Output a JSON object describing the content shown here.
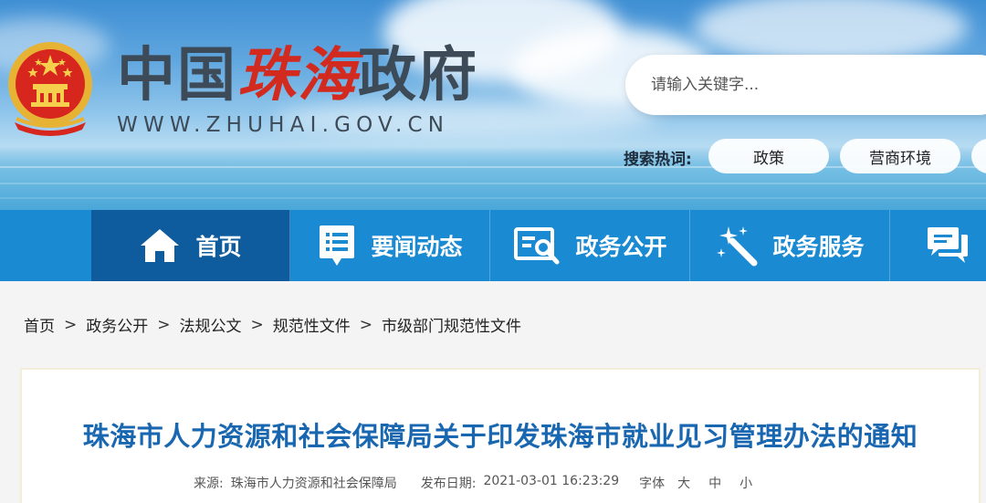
{
  "header": {
    "site_title_part1": "中国",
    "site_title_part2": "珠海",
    "site_title_part3": "政府",
    "domain": "WWW.ZHUHAI.GOV.CN",
    "search_placeholder": "请输入关键字...",
    "hot_label": "搜索热词:",
    "hot_words": [
      "政策",
      "营商环境"
    ]
  },
  "nav": {
    "items": [
      {
        "label": "首页",
        "icon": "home-icon",
        "active": true
      },
      {
        "label": "要闻动态",
        "icon": "news-list-icon"
      },
      {
        "label": "政务公开",
        "icon": "open-gov-icon"
      },
      {
        "label": "政务服务",
        "icon": "magic-wand-icon"
      },
      {
        "label": "",
        "icon": "chat-icon"
      }
    ]
  },
  "breadcrumb": [
    "首页",
    "政务公开",
    "法规公文",
    "规范性文件",
    "市级部门规范性文件"
  ],
  "article": {
    "title": "珠海市人力资源和社会保障局关于印发珠海市就业见习管理办法的通知",
    "source_label": "来源:",
    "source": "珠海市人力资源和社会保障局",
    "date_label": "发布日期:",
    "date": "2021-03-01 16:23:29",
    "font_label": "字体",
    "font_sizes": [
      "大",
      "中",
      "小"
    ]
  },
  "colors": {
    "nav_bg": "#1a8ad2",
    "nav_active": "#0e5b9d",
    "title_blue": "#1967b0",
    "logo_red": "#d32a1f"
  }
}
